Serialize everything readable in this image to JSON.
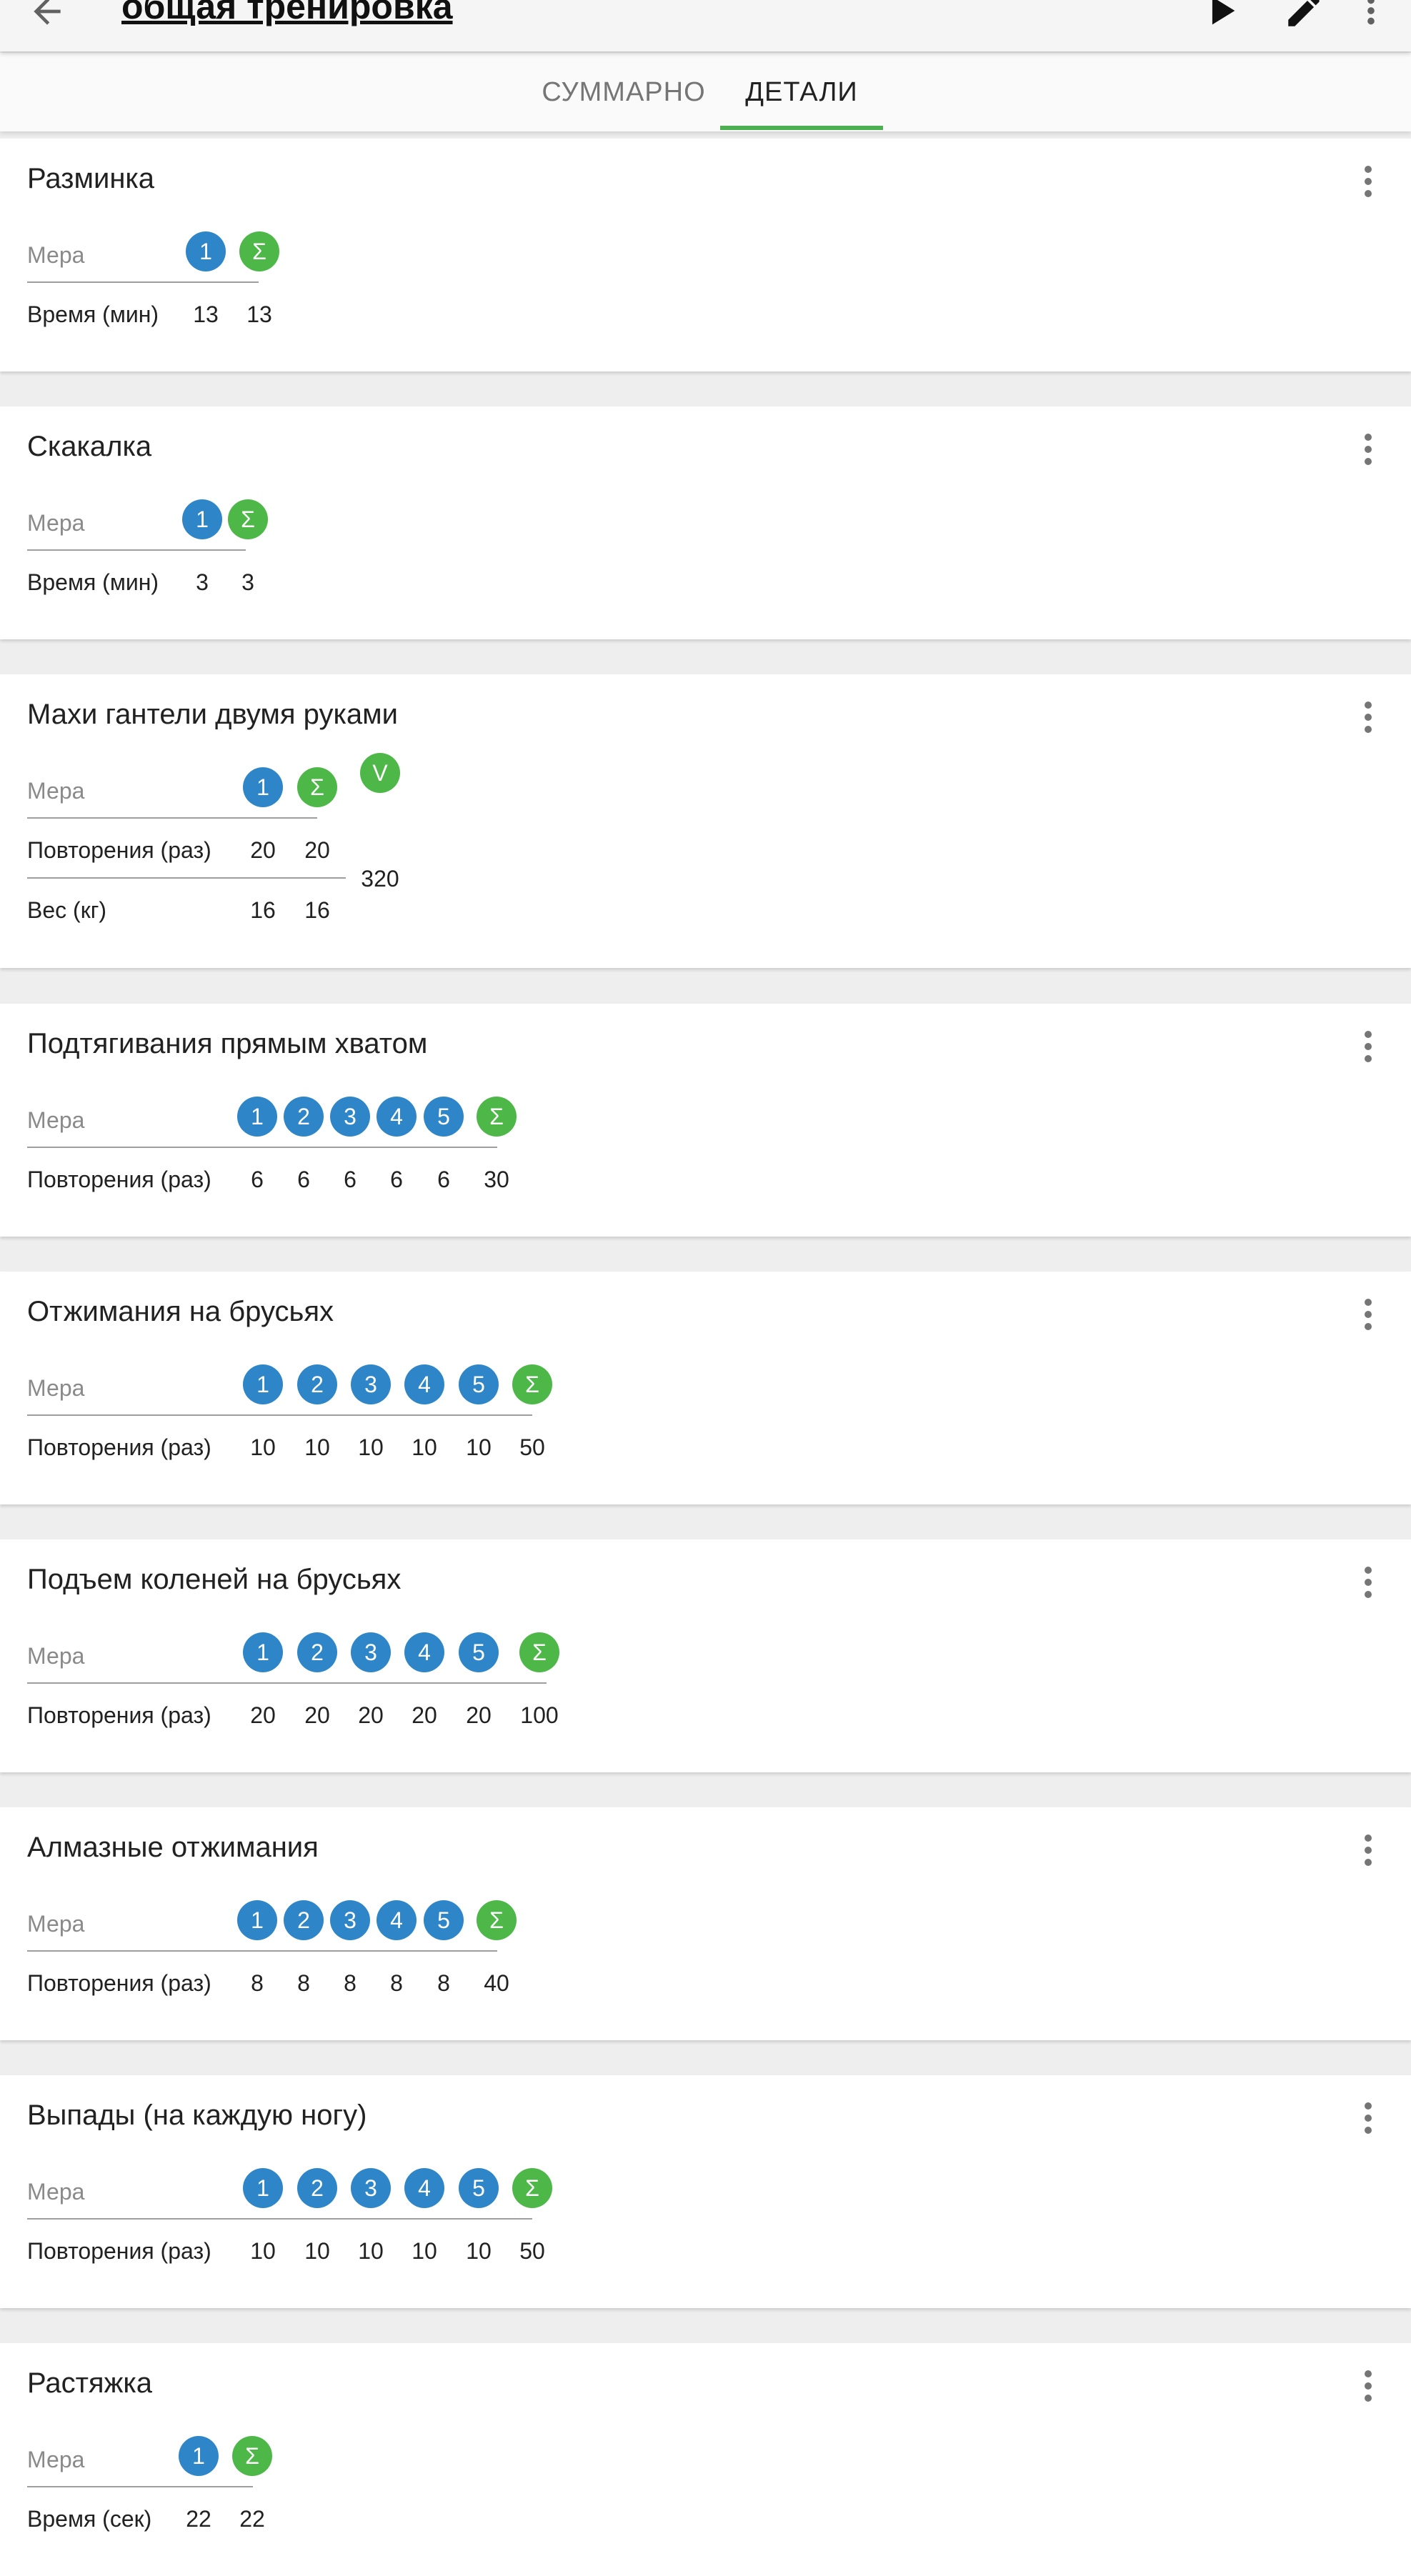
{
  "header": {
    "title": "общая тренировка"
  },
  "tabs": [
    {
      "label": "СУММАРНО",
      "active": false
    },
    {
      "label": "ДЕТАЛИ",
      "active": true
    }
  ],
  "colors": {
    "accent": "#4caf50",
    "set_badge": "#2e86c9",
    "sum_badge": "#4db848"
  },
  "icons": {
    "back": "arrow-left-icon",
    "play": "play-icon",
    "edit": "pencil-icon",
    "more": "more-vertical-icon"
  },
  "exercises": [
    {
      "name": "Разминка",
      "measure_label": "Мера",
      "headers": [
        "1",
        "Σ"
      ],
      "rows": [
        {
          "label": "Время (мин)",
          "values": [
            "13",
            "13"
          ]
        }
      ]
    },
    {
      "name": "Скакалка",
      "measure_label": "Мера",
      "headers": [
        "1",
        "Σ"
      ],
      "rows": [
        {
          "label": "Время (мин)",
          "values": [
            "3",
            "3"
          ]
        }
      ]
    },
    {
      "name": "Махи гантели двумя руками",
      "measure_label": "Мера",
      "headers": [
        "1",
        "Σ",
        "V"
      ],
      "rows": [
        {
          "label": "Повторения (раз)",
          "values": [
            "20",
            "20"
          ]
        },
        {
          "label": "Вес (кг)",
          "values": [
            "16",
            "16"
          ]
        }
      ],
      "volume": "320"
    },
    {
      "name": "Подтягивания прямым хватом",
      "measure_label": "Мера",
      "headers": [
        "1",
        "2",
        "3",
        "4",
        "5",
        "Σ"
      ],
      "rows": [
        {
          "label": "Повторения (раз)",
          "values": [
            "6",
            "6",
            "6",
            "6",
            "6",
            "30"
          ]
        }
      ]
    },
    {
      "name": "Отжимания на брусьях",
      "measure_label": "Мера",
      "headers": [
        "1",
        "2",
        "3",
        "4",
        "5",
        "Σ"
      ],
      "rows": [
        {
          "label": "Повторения (раз)",
          "values": [
            "10",
            "10",
            "10",
            "10",
            "10",
            "50"
          ]
        }
      ]
    },
    {
      "name": "Подъем коленей на брусьях",
      "measure_label": "Мера",
      "headers": [
        "1",
        "2",
        "3",
        "4",
        "5",
        "Σ"
      ],
      "rows": [
        {
          "label": "Повторения (раз)",
          "values": [
            "20",
            "20",
            "20",
            "20",
            "20",
            "100"
          ]
        }
      ]
    },
    {
      "name": "Алмазные отжимания",
      "measure_label": "Мера",
      "headers": [
        "1",
        "2",
        "3",
        "4",
        "5",
        "Σ"
      ],
      "rows": [
        {
          "label": "Повторения (раз)",
          "values": [
            "8",
            "8",
            "8",
            "8",
            "8",
            "40"
          ]
        }
      ]
    },
    {
      "name": "Выпады (на каждую ногу)",
      "measure_label": "Мера",
      "headers": [
        "1",
        "2",
        "3",
        "4",
        "5",
        "Σ"
      ],
      "rows": [
        {
          "label": "Повторения (раз)",
          "values": [
            "10",
            "10",
            "10",
            "10",
            "10",
            "50"
          ]
        }
      ]
    },
    {
      "name": "Растяжка",
      "measure_label": "Мера",
      "headers": [
        "1",
        "Σ"
      ],
      "rows": [
        {
          "label": "Время (сек)",
          "values": [
            "22",
            "22"
          ]
        }
      ]
    }
  ]
}
